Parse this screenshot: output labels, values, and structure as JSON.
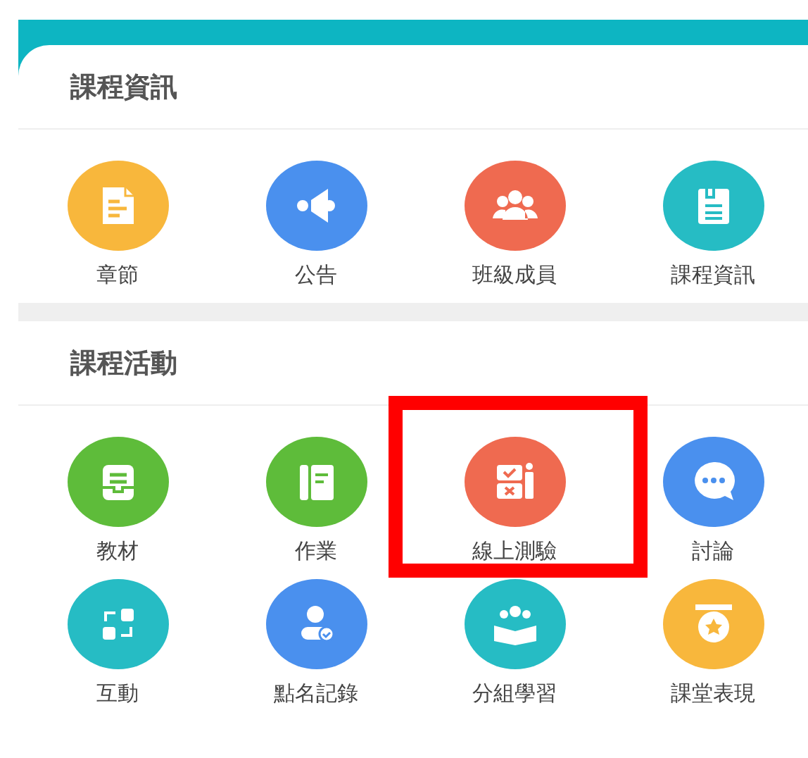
{
  "sections": [
    {
      "title": "課程資訊",
      "items": [
        {
          "label": "章節",
          "kind": "chapter",
          "color": "#f8b73c",
          "highlighted": false
        },
        {
          "label": "公告",
          "kind": "announcement",
          "color": "#4a90ee",
          "highlighted": false
        },
        {
          "label": "班級成員",
          "kind": "members",
          "color": "#ef6a50",
          "highlighted": false
        },
        {
          "label": "課程資訊",
          "kind": "info",
          "color": "#26bcc4",
          "highlighted": false
        }
      ]
    },
    {
      "title": "課程活動",
      "items": [
        {
          "label": "教材",
          "kind": "material",
          "color": "#5ebc3a",
          "highlighted": false
        },
        {
          "label": "作業",
          "kind": "homework",
          "color": "#5ebc3a",
          "highlighted": false
        },
        {
          "label": "線上測驗",
          "kind": "quiz",
          "color": "#ef6a50",
          "highlighted": true
        },
        {
          "label": "討論",
          "kind": "discussion",
          "color": "#4a90ee",
          "highlighted": false
        },
        {
          "label": "互動",
          "kind": "interact",
          "color": "#26bcc4",
          "highlighted": false
        },
        {
          "label": "點名記錄",
          "kind": "attendance",
          "color": "#4a90ee",
          "highlighted": false
        },
        {
          "label": "分組學習",
          "kind": "group",
          "color": "#26bcc4",
          "highlighted": false
        },
        {
          "label": "課堂表現",
          "kind": "performance",
          "color": "#f8b73c",
          "highlighted": false
        }
      ]
    }
  ]
}
